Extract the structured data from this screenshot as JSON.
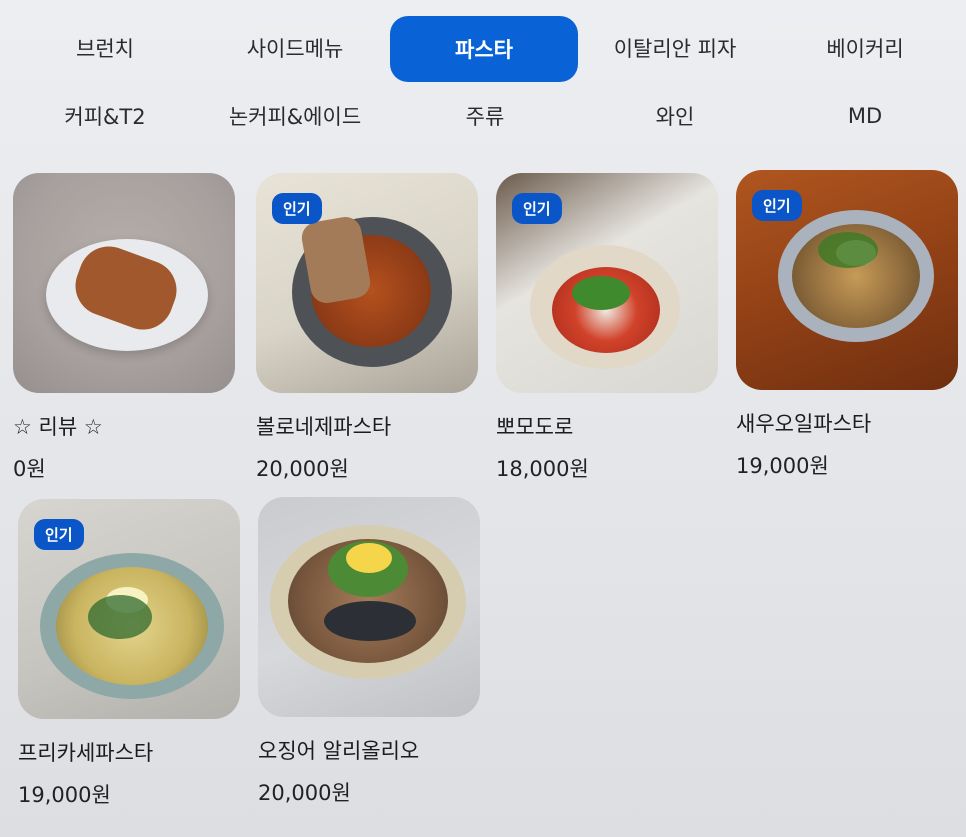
{
  "tabs": {
    "row1": [
      "브런치",
      "사이드메뉴",
      "파스타",
      "이탈리안 피자",
      "베이커리"
    ],
    "row2": [
      "커피&T2",
      "논커피&에이드",
      "주류",
      "와인",
      "MD"
    ],
    "active": "파스타"
  },
  "products": [
    {
      "name": "☆ 리뷰 ☆",
      "price": "0원",
      "badge": ""
    },
    {
      "name": "볼로네제파스타",
      "price": "20,000원",
      "badge": "인기"
    },
    {
      "name": "뽀모도로",
      "price": "18,000원",
      "badge": "인기"
    },
    {
      "name": "새우오일파스타",
      "price": "19,000원",
      "badge": "인기"
    },
    {
      "name": "프리카세파스타",
      "price": "19,000원",
      "badge": "인기"
    },
    {
      "name": "오징어 알리올리오",
      "price": "20,000원",
      "badge": ""
    }
  ],
  "colors": {
    "accent": "#0a63d6",
    "badge": "#0a55c7"
  }
}
